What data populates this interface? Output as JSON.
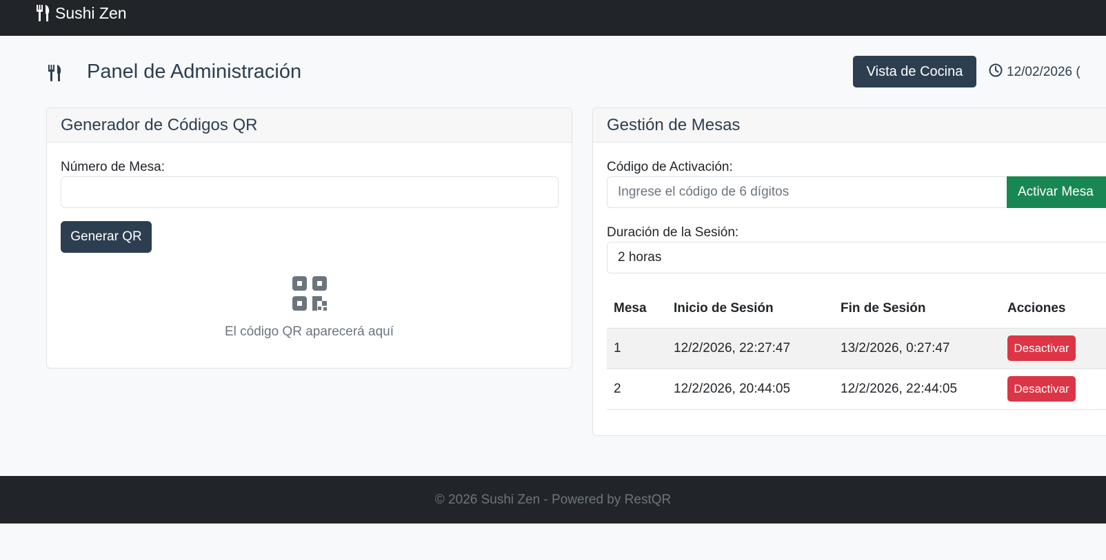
{
  "navbar": {
    "brand_icon": "utensils-icon",
    "brand_name": "Sushi Zen"
  },
  "header": {
    "icon": "utensils-icon",
    "title": "Panel de Administración",
    "kitchen_button": "Vista de Cocina",
    "clock_icon": "clock-icon",
    "datetime": "12/02/2026 ("
  },
  "qr_generator": {
    "title": "Generador de Códigos QR",
    "table_number_label": "Número de Mesa:",
    "table_number_value": "",
    "generate_button": "Generar QR",
    "qr_icon": "qrcode-icon",
    "placeholder_text": "El código QR aparecerá aquí"
  },
  "table_management": {
    "title": "Gestión de Mesas",
    "activation_label": "Código de Activación:",
    "activation_placeholder": "Ingrese el código de 6 dígitos",
    "activate_button": "Activar Mesa",
    "duration_label": "Duración de la Sesión:",
    "duration_selected": "2 horas",
    "columns": [
      "Mesa",
      "Inicio de Sesión",
      "Fin de Sesión",
      "Acciones"
    ],
    "rows": [
      {
        "mesa": "1",
        "inicio": "12/2/2026, 22:27:47",
        "fin": "13/2/2026, 0:27:47",
        "action": "Desactivar"
      },
      {
        "mesa": "2",
        "inicio": "12/2/2026, 20:44:05",
        "fin": "12/2/2026, 22:44:05",
        "action": "Desactivar"
      }
    ]
  },
  "footer": {
    "text": "© 2026 Sushi Zen - Powered by RestQR"
  },
  "colors": {
    "navbar": "#212529",
    "primary_dark": "#2c3e50",
    "success": "#198754",
    "danger": "#dc3545",
    "background": "#f8f9fa"
  }
}
